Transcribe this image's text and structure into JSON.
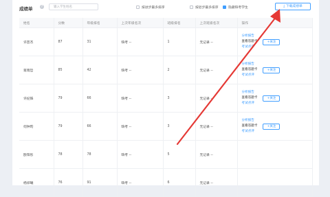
{
  "header": {
    "title": "成绩单",
    "help_icon": "question-icon",
    "search_placeholder": "输入学生姓名",
    "checkbox1": "按进步最多排序",
    "checkbox2": "按退步最多排序",
    "checkbox3": "隐藏缺考学生",
    "checkbox3_checked": true,
    "download": "下载成绩单"
  },
  "table": {
    "columns": [
      "姓名",
      "分数",
      "年级排名",
      "上次年级名次",
      "班级排名",
      "上次班级名次",
      "操作"
    ],
    "rows": [
      {
        "name": "许芸杰",
        "score": "87",
        "grade_rank": "31",
        "last_grade": "缺考 --",
        "class_rank": "1",
        "last_class": "无记录 --",
        "link1": "分析报告",
        "link2": "查看答题卡",
        "link3": "考试点评",
        "follow": "+关注"
      },
      {
        "name": "蒋雨哲",
        "score": "85",
        "grade_rank": "42",
        "last_grade": "缺考 --",
        "class_rank": "2",
        "last_class": "无记录 --",
        "link1": "分析报告",
        "link2": "查看答题卡",
        "link3": "考试点评",
        "follow": "+关注"
      },
      {
        "name": "许纪铢",
        "score": "79",
        "grade_rank": "66",
        "last_grade": "缺考 --",
        "class_rank": "3",
        "last_class": "无记录 --",
        "link1": "分析报告",
        "link2": "查看答题卡",
        "link3": "考试点评",
        "follow": "+关注"
      },
      {
        "name": "何钟昀",
        "score": "79",
        "grade_rank": "66",
        "last_grade": "缺考 --",
        "class_rank": "3",
        "last_class": "无记录 --",
        "link1": "分析报告",
        "link2": "查看答题卡",
        "link3": "考试点评",
        "follow": "+关注"
      },
      {
        "name": "欧阳彤",
        "score": "78",
        "grade_rank": "78",
        "last_grade": "缺考 --",
        "class_rank": "5",
        "last_class": "无记录 --",
        "link1": "",
        "link2": "",
        "link3": "",
        "follow": ""
      },
      {
        "name": "杨烨曦",
        "score": "76",
        "grade_rank": "91",
        "last_grade": "缺考 --",
        "class_rank": "6",
        "last_class": "无记录 --",
        "link1": "",
        "link2": "",
        "link3": "",
        "follow": ""
      }
    ]
  },
  "colors": {
    "accent": "#409eff",
    "arrow": "#e53935"
  }
}
